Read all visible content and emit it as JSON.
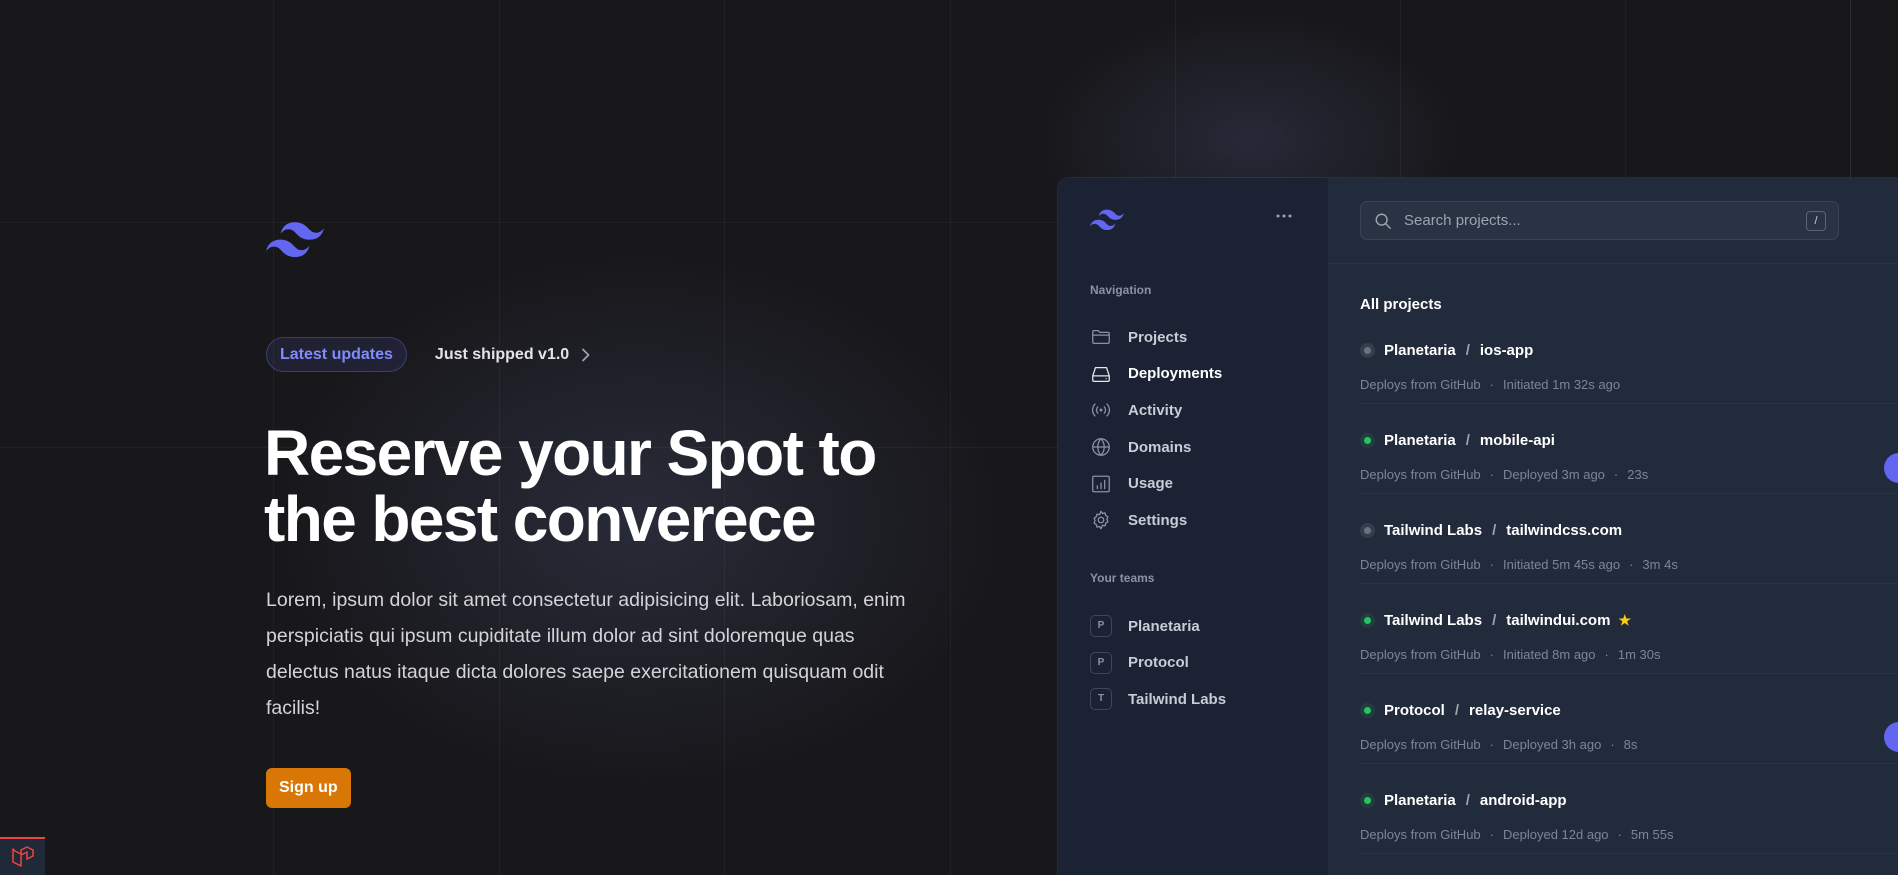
{
  "hero": {
    "badge": "Latest updates",
    "shipped_link": "Just shipped v1.0",
    "title": "Reserve your Spot to the best converece",
    "description": "Lorem, ipsum dolor sit amet consectetur adipisicing elit. Laboriosam, enim perspiciatis qui ipsum cupiditate illum dolor ad sint doloremque quas delectus natus itaque dicta dolores saepe exercitationem quisquam odit facilis!",
    "signup_label": "Sign up"
  },
  "colors": {
    "accent": "#818cf8",
    "signup": "#d97706",
    "success": "#22c55e",
    "idle": "#6b7280",
    "star": "#facc15"
  },
  "sidebar": {
    "navigation_heading": "Navigation",
    "nav_items": [
      {
        "label": "Projects",
        "icon": "folder-icon"
      },
      {
        "label": "Deployments",
        "icon": "server-icon",
        "active": true
      },
      {
        "label": "Activity",
        "icon": "signal-icon"
      },
      {
        "label": "Domains",
        "icon": "globe-icon"
      },
      {
        "label": "Usage",
        "icon": "chart-bar-icon"
      },
      {
        "label": "Settings",
        "icon": "gear-icon"
      }
    ],
    "teams_heading": "Your teams",
    "teams": [
      {
        "initial": "P",
        "name": "Planetaria"
      },
      {
        "initial": "P",
        "name": "Protocol"
      },
      {
        "initial": "T",
        "name": "Tailwind Labs"
      }
    ]
  },
  "search": {
    "placeholder": "Search projects...",
    "shortcut": "/"
  },
  "projects": {
    "heading": "All projects",
    "items": [
      {
        "team": "Planetaria",
        "name": "ios-app",
        "status": "idle",
        "source": "Deploys from GitHub",
        "state": "Initiated 1m 32s ago",
        "duration": "",
        "starred": false
      },
      {
        "team": "Planetaria",
        "name": "mobile-api",
        "status": "ok",
        "source": "Deploys from GitHub",
        "state": "Deployed 3m ago",
        "duration": "23s",
        "starred": false
      },
      {
        "team": "Tailwind Labs",
        "name": "tailwindcss.com",
        "status": "idle",
        "source": "Deploys from GitHub",
        "state": "Initiated 5m 45s ago",
        "duration": "3m 4s",
        "starred": false
      },
      {
        "team": "Tailwind Labs",
        "name": "tailwindui.com",
        "status": "ok",
        "source": "Deploys from GitHub",
        "state": "Initiated 8m ago",
        "duration": "1m 30s",
        "starred": true
      },
      {
        "team": "Protocol",
        "name": "relay-service",
        "status": "ok",
        "source": "Deploys from GitHub",
        "state": "Deployed 3h ago",
        "duration": "8s",
        "starred": false
      },
      {
        "team": "Planetaria",
        "name": "android-app",
        "status": "ok",
        "source": "Deploys from GitHub",
        "state": "Deployed 12d ago",
        "duration": "5m 55s",
        "starred": false
      }
    ]
  }
}
